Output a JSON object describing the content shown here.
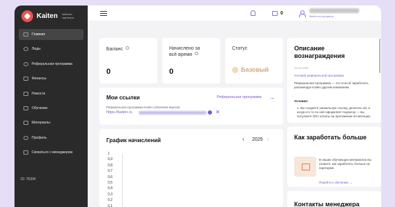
{
  "brand": {
    "name": "Kaiten",
    "subtitle": "Кабинет партнера"
  },
  "nav": [
    {
      "label": "Главная",
      "icon": "home-icon",
      "active": true
    },
    {
      "label": "Лиды",
      "icon": "users-icon"
    },
    {
      "label": "Реферальная программа",
      "icon": "link-icon"
    },
    {
      "label": "Финансы",
      "icon": "wallet-icon"
    },
    {
      "label": "Новости",
      "icon": "news-icon"
    },
    {
      "label": "Обучение",
      "icon": "book-icon"
    },
    {
      "label": "Материалы",
      "icon": "folder-icon"
    },
    {
      "label": "Профиль",
      "icon": "user-icon"
    },
    {
      "label": "Связаться с менеджером",
      "icon": "chat-icon"
    }
  ],
  "user_id": "ID: 76394",
  "header": {
    "wallet_count": "0",
    "logout": "Выйти из профиля"
  },
  "cards": {
    "balance": {
      "label": "Баланс",
      "value": "0"
    },
    "accrued": {
      "label": "Начислено за всё время",
      "value": "0"
    },
    "status": {
      "label": "Статус",
      "value": "Базовый"
    }
  },
  "links": {
    "title": "Мои ссылки",
    "program_link": "Реферальная программа",
    "program_name": "Реферальная программа Kaiten (облачная версия)",
    "url": "https://kaiten.ru"
  },
  "chart_data": {
    "type": "bar",
    "title": "График начислений",
    "year": "2025",
    "y_ticks": [
      "1",
      "0,9",
      "0,8",
      "0,7",
      "0,6",
      "0,5",
      "0,4",
      "0,3",
      "0,2",
      "0,1"
    ],
    "categories": [],
    "values": []
  },
  "right": {
    "reward": {
      "title": "Описание вознаграждения",
      "date": "10.04.2025",
      "link": "Условия реферальной программы",
      "para": "Реферальная программа — это способ заработать, рекомендуя Kaiten другим компаниям.",
      "conditions_label": "Условия:",
      "item": "1. Вы создаете уникальную ссылку, делитесь ей, а когда кто-то по ней оформляет подписку — вы получаете 20% оплаты на протяжении 24 месяцев."
    },
    "earn": {
      "title": "Как заработать больше",
      "text": "В наших обучающих материалах вы узнаете, как заработать больше на партнерке.",
      "link": "Перейти к обучению"
    },
    "contacts": {
      "title": "Контакты менеджера"
    }
  },
  "colors": {
    "accent": "#7b57d1",
    "sidebar": "#2a2a2a",
    "background": "#e6def6",
    "logo": "#e95353"
  }
}
